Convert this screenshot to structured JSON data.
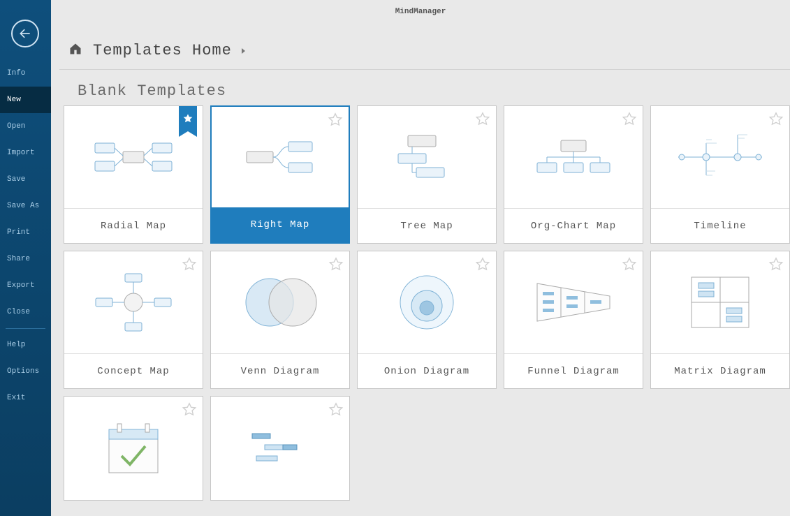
{
  "app_title": "MindManager",
  "sidebar": {
    "items": [
      {
        "id": "info",
        "label": "Info"
      },
      {
        "id": "new",
        "label": "New"
      },
      {
        "id": "open",
        "label": "Open"
      },
      {
        "id": "import",
        "label": "Import"
      },
      {
        "id": "save",
        "label": "Save"
      },
      {
        "id": "saveas",
        "label": "Save As"
      },
      {
        "id": "print",
        "label": "Print"
      },
      {
        "id": "share",
        "label": "Share"
      },
      {
        "id": "export",
        "label": "Export"
      },
      {
        "id": "close",
        "label": "Close"
      }
    ],
    "items2": [
      {
        "id": "help",
        "label": "Help"
      },
      {
        "id": "options",
        "label": "Options"
      },
      {
        "id": "exit",
        "label": "Exit"
      }
    ],
    "active_id": "new"
  },
  "breadcrumb": {
    "label": "Templates Home"
  },
  "section_title": "Blank Templates",
  "templates": [
    {
      "id": "radial",
      "label": "Radial Map",
      "favorite": true,
      "selected": false
    },
    {
      "id": "right",
      "label": "Right Map",
      "favorite": false,
      "selected": true
    },
    {
      "id": "tree",
      "label": "Tree Map",
      "favorite": false,
      "selected": false
    },
    {
      "id": "org",
      "label": "Org-Chart Map",
      "favorite": false,
      "selected": false
    },
    {
      "id": "timeline",
      "label": "Timeline",
      "favorite": false,
      "selected": false
    },
    {
      "id": "concept",
      "label": "Concept Map",
      "favorite": false,
      "selected": false
    },
    {
      "id": "venn",
      "label": "Venn Diagram",
      "favorite": false,
      "selected": false
    },
    {
      "id": "onion",
      "label": "Onion Diagram",
      "favorite": false,
      "selected": false
    },
    {
      "id": "funnel",
      "label": "Funnel Diagram",
      "favorite": false,
      "selected": false
    },
    {
      "id": "matrix",
      "label": "Matrix Diagram",
      "favorite": false,
      "selected": false
    },
    {
      "id": "calendar",
      "label": "",
      "favorite": false,
      "selected": false
    },
    {
      "id": "gantt",
      "label": "",
      "favorite": false,
      "selected": false
    }
  ]
}
